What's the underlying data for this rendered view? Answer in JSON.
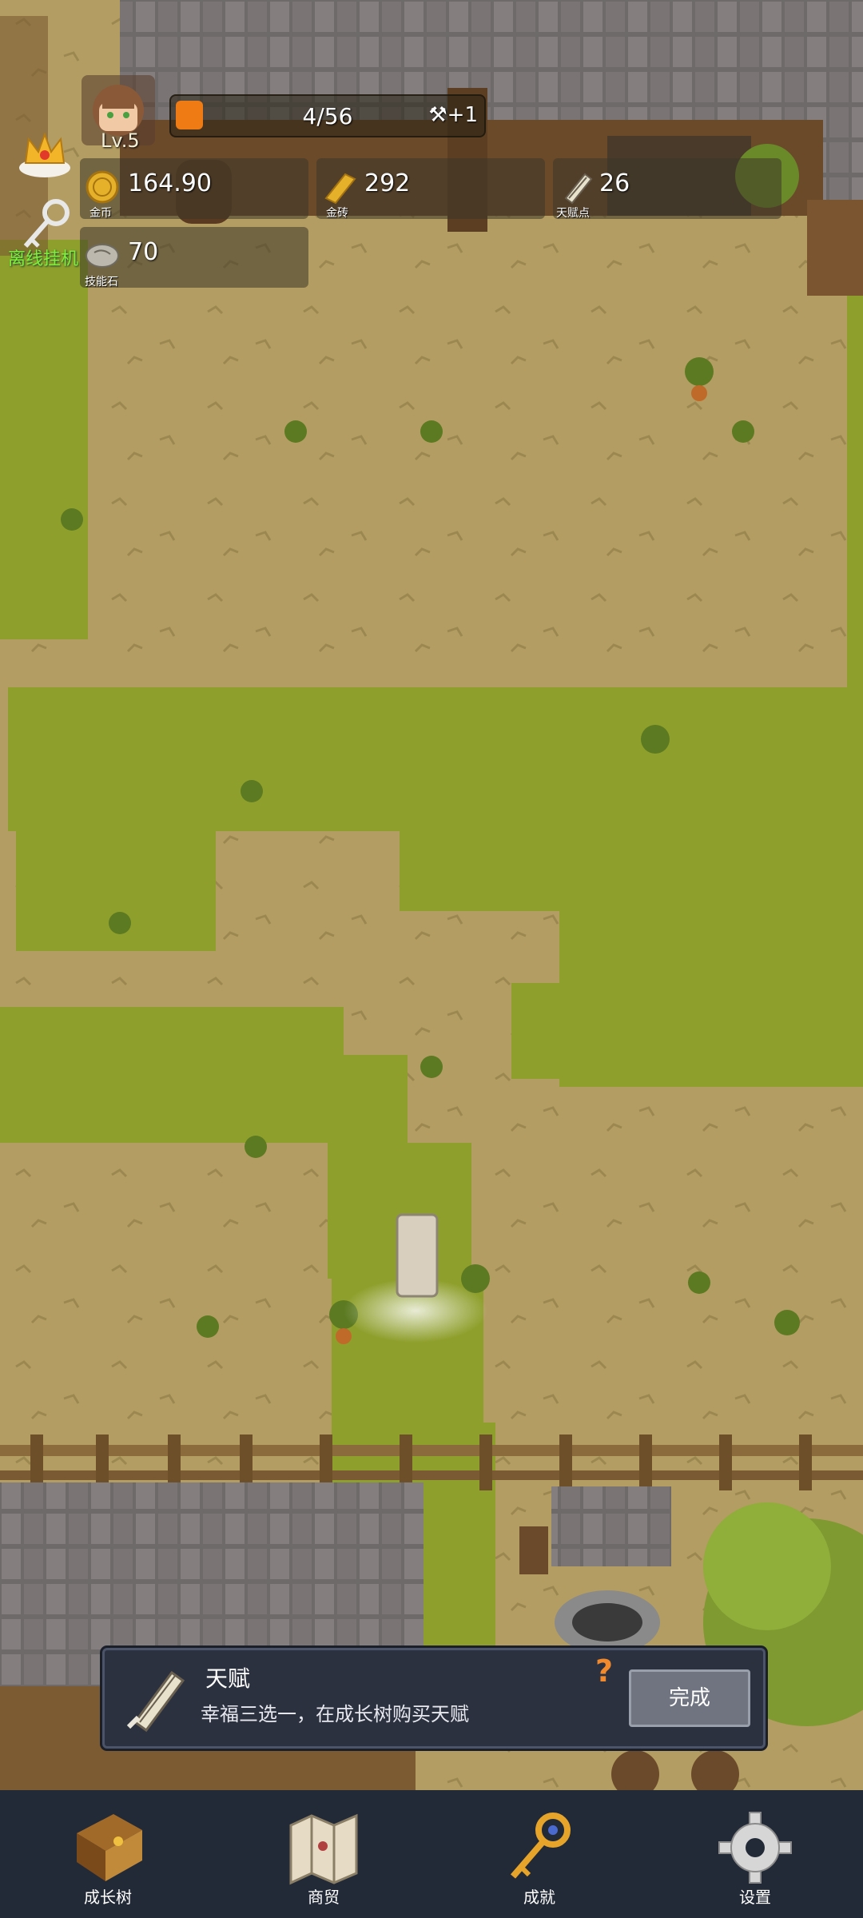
{
  "hud": {
    "level": "Lv.5",
    "xp_text": "4/56",
    "xp_progress": 0.07,
    "xp_bonus": "+1",
    "idle_label": "离线挂机",
    "resources": [
      {
        "value": "164.90",
        "label": "金币",
        "icon": "gold-coin-icon"
      },
      {
        "value": "292",
        "label": "金砖",
        "icon": "gold-brick-icon"
      },
      {
        "value": "26",
        "label": "天赋点",
        "icon": "talent-scroll-icon"
      },
      {
        "value": "70",
        "label": "技能石",
        "icon": "skill-stone-icon"
      }
    ]
  },
  "task": {
    "title": "天赋",
    "description": "幸福三选一，在成长树购买天赋",
    "help": "?",
    "done_label": "完成",
    "icon": "scroll-quill-icon"
  },
  "nav": [
    {
      "label": "成长树",
      "icon": "book-icon"
    },
    {
      "label": "商贸",
      "icon": "map-icon"
    },
    {
      "label": "成就",
      "icon": "key-icon"
    },
    {
      "label": "设置",
      "icon": "gear-icon"
    }
  ],
  "colors": {
    "dirt": "#b39d62",
    "grass": "#8f9f2c",
    "nav_bg": "#232a37",
    "panel_bg": "#2c3140",
    "xp_fill": "#ee7b14",
    "idle_text": "#7ef03a"
  }
}
